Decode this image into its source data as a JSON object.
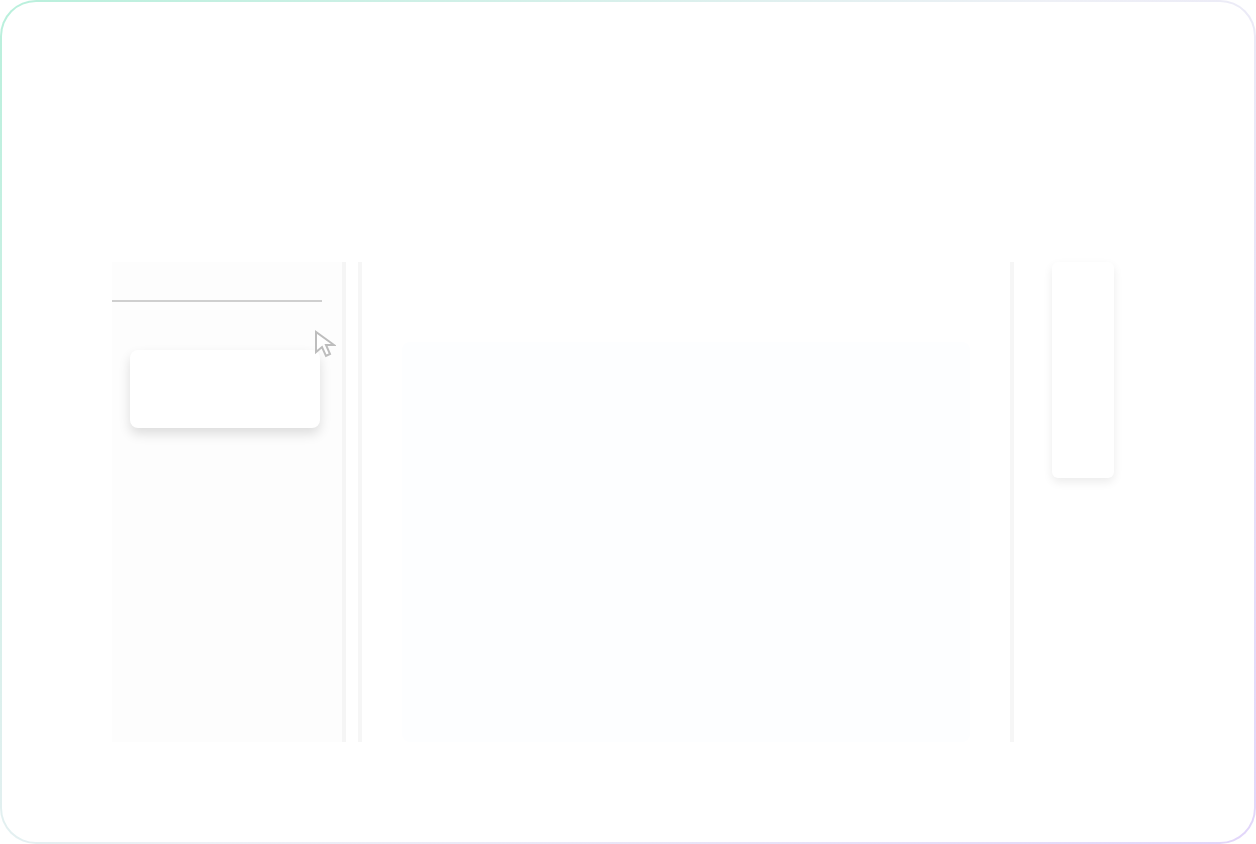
{
  "panels": [
    {
      "kind": "sidebar"
    },
    {
      "kind": "content"
    },
    {
      "kind": "rail"
    }
  ]
}
